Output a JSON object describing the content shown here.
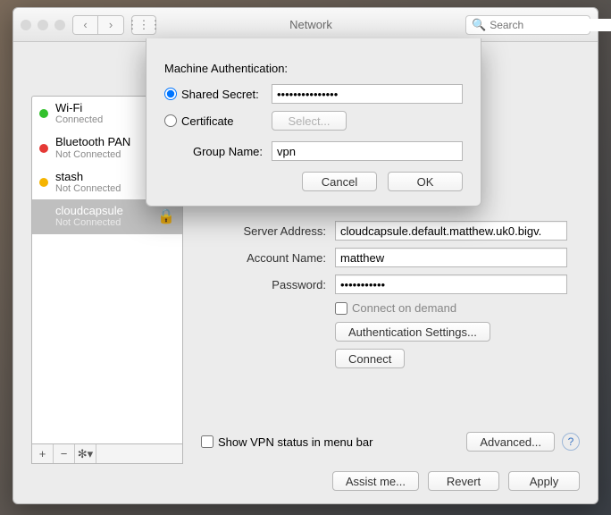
{
  "window": {
    "title": "Network",
    "search_placeholder": "Search",
    "nav_back": "‹",
    "nav_fwd": "›",
    "apps_icon": "⋮⋮⋮"
  },
  "sidebar": {
    "items": [
      {
        "name": "Wi-Fi",
        "status": "Connected",
        "dot": "green"
      },
      {
        "name": "Bluetooth PAN",
        "status": "Not Connected",
        "dot": "red"
      },
      {
        "name": "stash",
        "status": "Not Connected",
        "dot": "yellow"
      },
      {
        "name": "cloudcapsule",
        "status": "Not Connected",
        "dot": "none"
      }
    ],
    "add": "+",
    "remove": "−",
    "gear": "✻▾"
  },
  "form": {
    "server_label": "Server Address:",
    "server_value": "cloudcapsule.default.matthew.uk0.bigv.",
    "account_label": "Account Name:",
    "account_value": "matthew",
    "password_label": "Password:",
    "password_value": "•••••••••••",
    "connect_on_demand": "Connect on demand",
    "auth_settings": "Authentication Settings...",
    "connect": "Connect"
  },
  "bottom": {
    "show_status": "Show VPN status in menu bar",
    "advanced": "Advanced...",
    "help": "?"
  },
  "footer": {
    "assist": "Assist me...",
    "revert": "Revert",
    "apply": "Apply"
  },
  "sheet": {
    "heading": "Machine Authentication:",
    "shared_label": "Shared Secret:",
    "shared_value": "•••••••••••••••",
    "cert_label": "Certificate",
    "select": "Select...",
    "group_label": "Group Name:",
    "group_value": "vpn",
    "cancel": "Cancel",
    "ok": "OK"
  }
}
